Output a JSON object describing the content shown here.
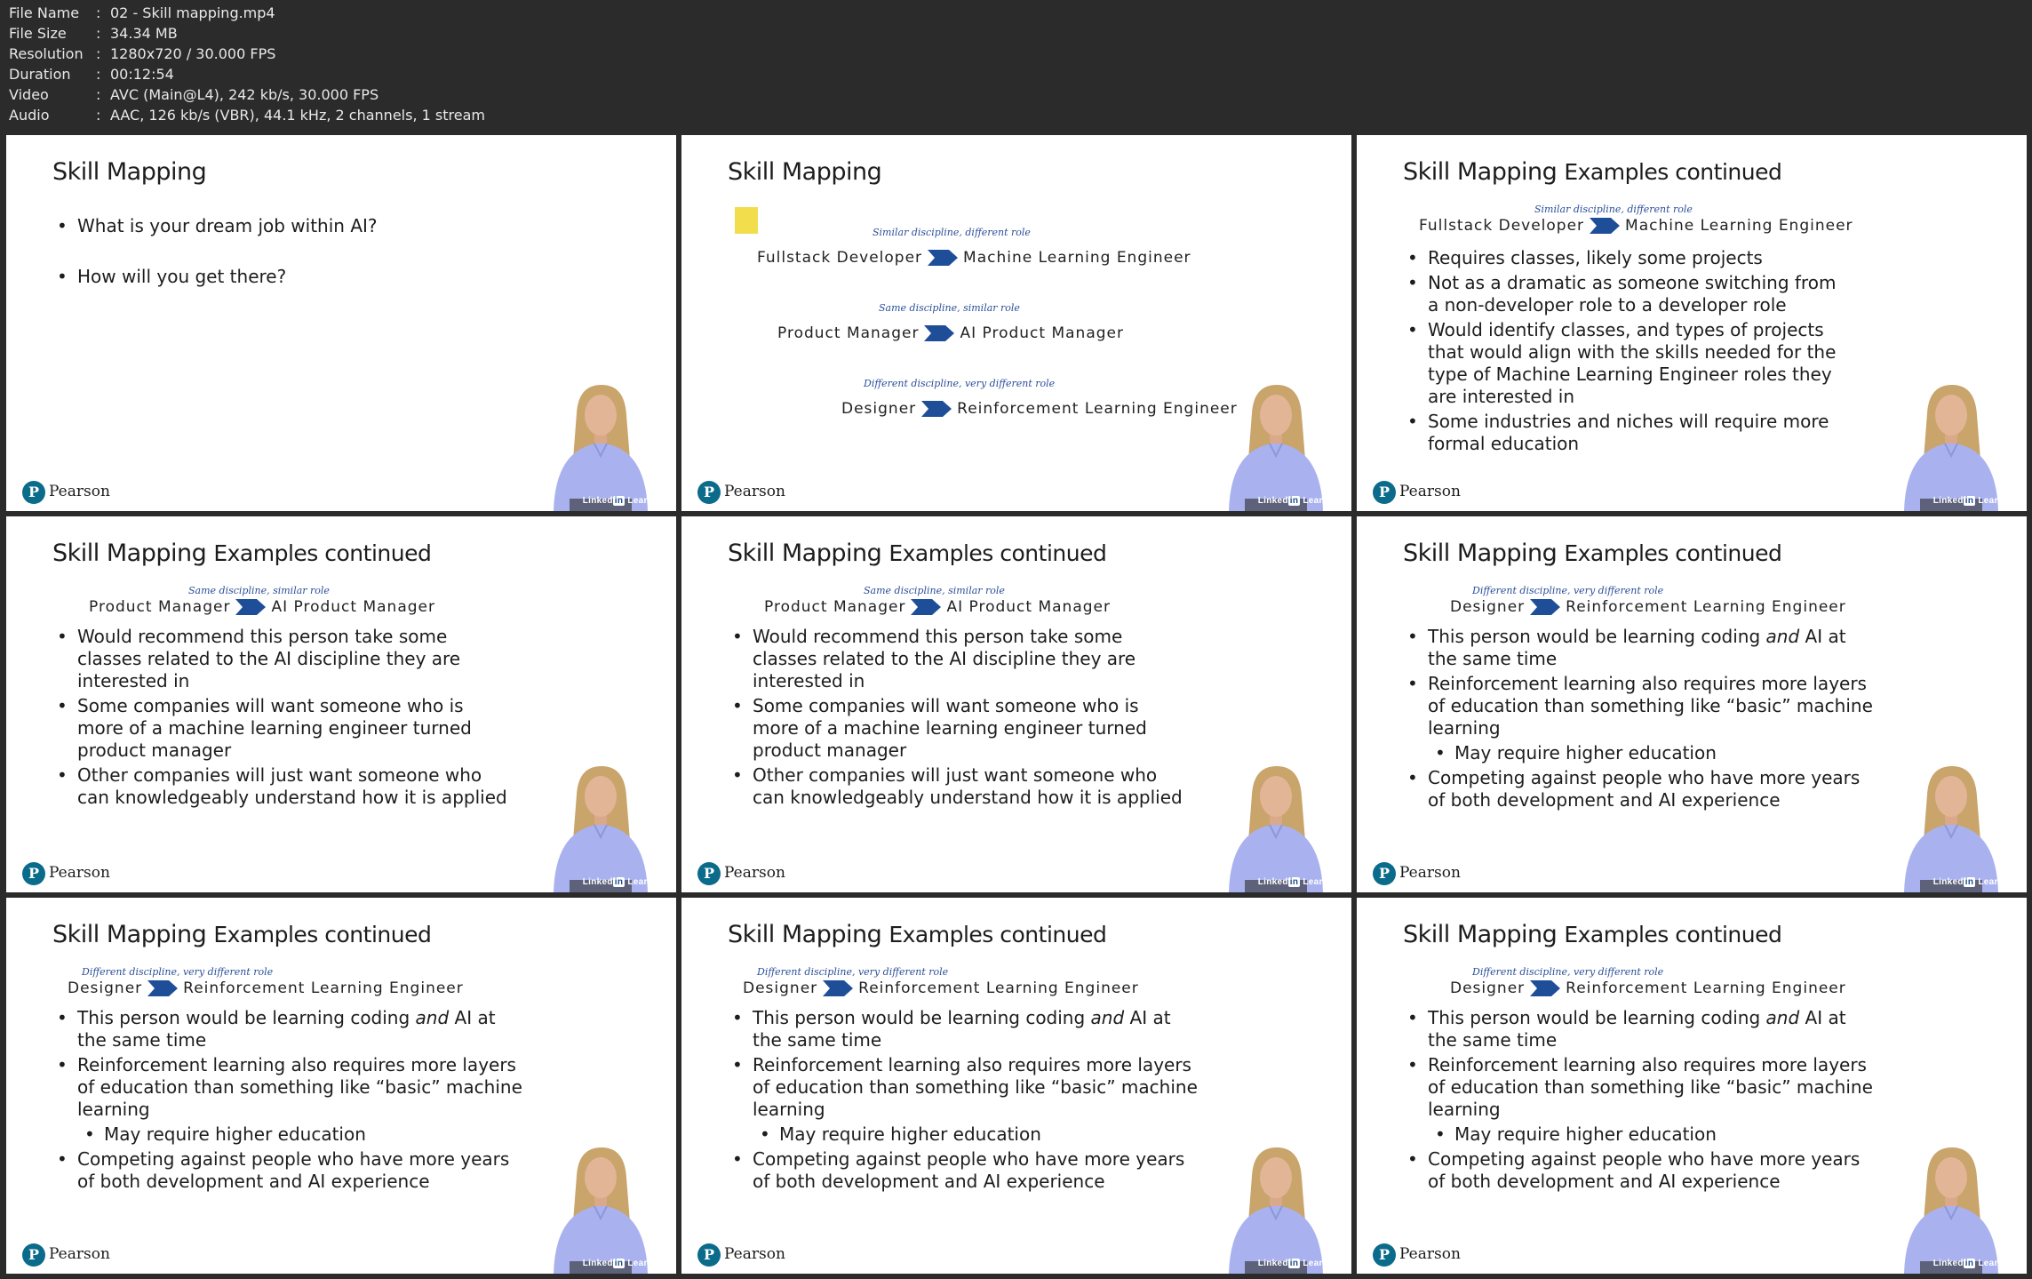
{
  "meta": [
    {
      "key": "File Name",
      "sep": ":",
      "value": "02 - Skill mapping.mp4"
    },
    {
      "key": "File Size",
      "sep": ":",
      "value": "34.34 MB"
    },
    {
      "key": "Resolution",
      "sep": ":",
      "value": "1280x720 / 30.000 FPS"
    },
    {
      "key": "Duration",
      "sep": ":",
      "value": "00:12:54"
    },
    {
      "key": "Video",
      "sep": ":",
      "value": "AVC (Main@L4), 242 kb/s, 30.000 FPS"
    },
    {
      "key": "Audio",
      "sep": ":",
      "value": "AAC, 126 kb/s (VBR), 44.1 kHz, 2 channels, 1 stream"
    }
  ],
  "brand": {
    "pearson": "Pearson",
    "p_letter": "P",
    "linkedin_a": "Linked",
    "linkedin_in": "in",
    "linkedin_b": " Learning"
  },
  "colors": {
    "chevron": "#1f4e99",
    "pearson_mark": "#0a6b8a",
    "sticky": "#f2dd4d",
    "note": "#2b4f9a"
  },
  "thumbs": [
    {
      "title": "Skill Mapping",
      "title_cont": "",
      "bullets": [
        "What is your dream job within AI?",
        "How will you get there?"
      ]
    },
    {
      "title": "Skill Mapping",
      "title_cont": "",
      "maps": [
        {
          "note": "Similar discipline, different role",
          "from": "Fullstack Developer",
          "to": "Machine Learning Engineer"
        },
        {
          "note": "Same discipline, similar role",
          "from": "Product Manager",
          "to": "AI Product Manager"
        },
        {
          "note": "Different discipline, very different role",
          "from": "Designer",
          "to": "Reinforcement Learning Engineer"
        }
      ]
    },
    {
      "title": "Skill Mapping",
      "title_cont": "Examples continued",
      "map": {
        "note": "Similar discipline, different role",
        "from": "Fullstack Developer",
        "to": "Machine Learning Engineer"
      },
      "bullets": [
        "Requires classes, likely some projects",
        "Not as a dramatic as someone switching from a non-developer role to a developer role",
        "Would identify classes, and types of projects that would align with the skills needed for the type of Machine Learning Engineer roles they are interested in",
        "Some industries and niches will require more formal education"
      ]
    },
    {
      "title": "Skill Mapping",
      "title_cont": "Examples continued",
      "map": {
        "note": "Same discipline, similar role",
        "from": "Product Manager",
        "to": "AI Product Manager"
      },
      "bullets": [
        "Would recommend this person take some classes related to the AI discipline they are interested in",
        "Some companies will want someone who is more of a machine learning engineer turned product manager",
        "Other companies will just want someone who can knowledgeably understand how it is applied"
      ]
    },
    {
      "title": "Skill Mapping",
      "title_cont": "Examples continued",
      "map": {
        "note": "Same discipline, similar role",
        "from": "Product Manager",
        "to": "AI Product Manager"
      },
      "bullets": [
        "Would recommend this person take some classes related to the AI discipline they are interested in",
        "Some companies will want someone who is more of a machine learning engineer turned product manager",
        "Other companies will just want someone who can knowledgeably understand how it is applied"
      ]
    },
    {
      "title": "Skill Mapping",
      "title_cont": "Examples continued",
      "map": {
        "note": "Different discipline, very different role",
        "from": "Designer",
        "to": "Reinforcement Learning Engineer"
      },
      "bullets6": {
        "b1a": "This person would be learning coding ",
        "b1i": "and",
        "b1b": " AI at the same time",
        "b2": "Reinforcement learning also requires more layers of education than something like “basic” machine learning",
        "b3": "May require higher education",
        "b4": "Competing against people who have more years of both development and AI experience"
      }
    },
    {
      "title": "Skill Mapping",
      "title_cont": "Examples continued",
      "map": {
        "note": "Different discipline, very different role",
        "from": "Designer",
        "to": "Reinforcement Learning Engineer"
      },
      "bullets6": {
        "b1a": "This person would be learning coding ",
        "b1i": "and",
        "b1b": " AI at the same time",
        "b2": "Reinforcement learning also requires more layers of education than something like “basic” machine learning",
        "b3": "May require higher education",
        "b4": "Competing against people who have more years of both development and AI experience"
      }
    },
    {
      "title": "Skill Mapping",
      "title_cont": "Examples continued",
      "map": {
        "note": "Different discipline, very different role",
        "from": "Designer",
        "to": "Reinforcement Learning Engineer"
      },
      "bullets6": {
        "b1a": "This person would be learning coding ",
        "b1i": "and",
        "b1b": " AI at the same time",
        "b2": "Reinforcement learning also requires more layers of education than something like “basic” machine learning",
        "b3": "May require higher education",
        "b4": "Competing against people who have more years of both development and AI experience"
      }
    },
    {
      "title": "Skill Mapping",
      "title_cont": "Examples continued",
      "map": {
        "note": "Different discipline, very different role",
        "from": "Designer",
        "to": "Reinforcement Learning Engineer"
      },
      "bullets6": {
        "b1a": "This person would be learning coding ",
        "b1i": "and",
        "b1b": " AI at the same time",
        "b2": "Reinforcement learning also requires more layers of education than something like “basic” machine learning",
        "b3": "May require higher education",
        "b4": "Competing against people who have more years of both development and AI experience"
      }
    }
  ]
}
